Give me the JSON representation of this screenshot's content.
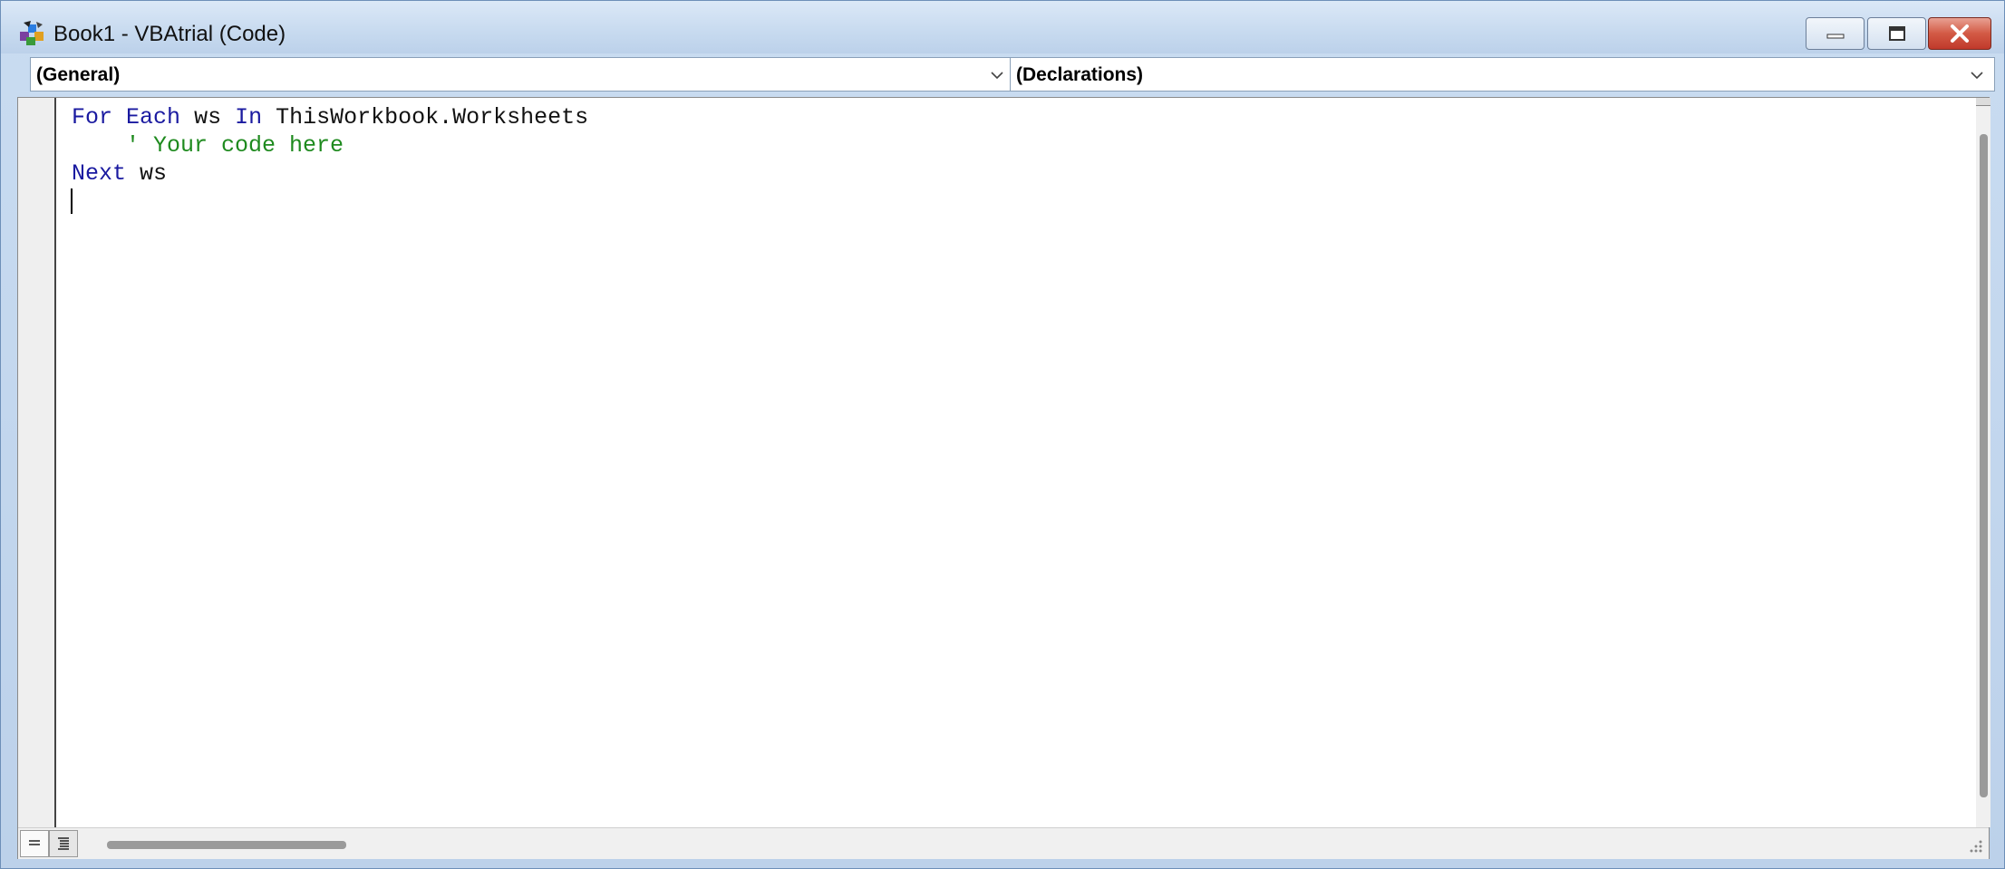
{
  "window": {
    "title": "Book1 - VBAtrial (Code)",
    "icon": "vba-project-icon"
  },
  "controls": {
    "minimize_icon": "minimize-icon",
    "maximize_icon": "maximize-icon",
    "close_icon": "close-icon"
  },
  "toolbar": {
    "object_combo": "(General)",
    "procedure_combo": "(Declarations)"
  },
  "code": {
    "line1": {
      "kw1": "For",
      "kw2": "Each",
      "var": "ws",
      "kw3": "In",
      "obj": "ThisWorkbook.Worksheets"
    },
    "line2": {
      "indent": "    ",
      "comment": "' Your code here"
    },
    "line3": {
      "kw": "Next",
      "var": "ws"
    }
  },
  "colors": {
    "keyword": "#1a1aa0",
    "comment": "#1e8a1e",
    "close_button": "#c0392b"
  }
}
